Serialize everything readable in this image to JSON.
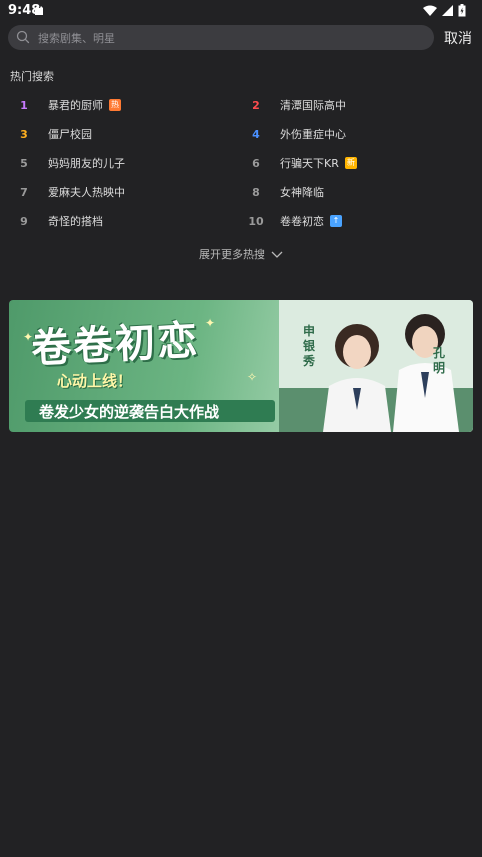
{
  "status_bar": {
    "time": "9:48"
  },
  "search": {
    "placeholder": "搜索剧集、明星",
    "cancel_label": "取消"
  },
  "hot_search": {
    "title": "热门搜索",
    "items": [
      {
        "rank": "1",
        "title": "暴君的厨师",
        "rank_color": "#c77bff",
        "badge": "热",
        "badge_color": "#ff7a33"
      },
      {
        "rank": "2",
        "title": "清潭国际高中",
        "rank_color": "#ff4d4f"
      },
      {
        "rank": "3",
        "title": "僵尸校园",
        "rank_color": "#ffb020"
      },
      {
        "rank": "4",
        "title": "外伤重症中心",
        "rank_color": "#4a90ff"
      },
      {
        "rank": "5",
        "title": "妈妈朋友的儿子",
        "rank_color": "#9a9a9a"
      },
      {
        "rank": "6",
        "title": "行骗天下KR",
        "rank_color": "#9a9a9a",
        "badge": "新",
        "badge_color": "#ffb400"
      },
      {
        "rank": "7",
        "title": "爱麻夫人热映中",
        "rank_color": "#9a9a9a"
      },
      {
        "rank": "8",
        "title": "女神降临",
        "rank_color": "#9a9a9a"
      },
      {
        "rank": "9",
        "title": "奇怪的搭档",
        "rank_color": "#9a9a9a"
      },
      {
        "rank": "10",
        "title": "卷卷初恋",
        "rank_color": "#9a9a9a",
        "badge": "↑",
        "badge_color": "#4aa3ff"
      }
    ],
    "expand_label": "展开更多热搜"
  },
  "banner": {
    "title": "卷卷初恋",
    "subtitle": "心动上线！",
    "slogan": "卷发少女的逆袭告白大作战",
    "actor_1": "申银秀",
    "actor_2": "孔明"
  }
}
